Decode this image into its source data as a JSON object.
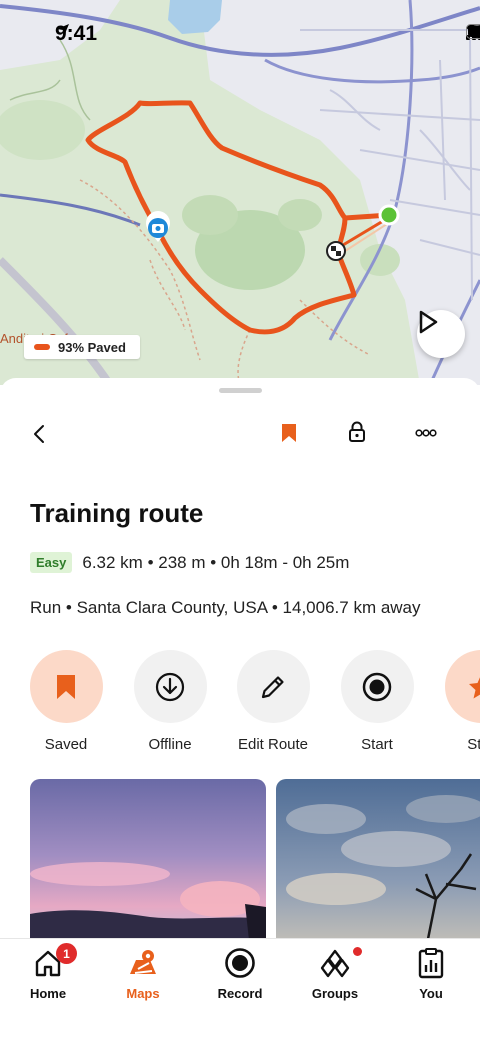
{
  "status_bar": {
    "time": "9:41"
  },
  "map": {
    "surface_label": "93% Paved",
    "place_label": "Anditeri Cafe",
    "route_color": "#e8541c",
    "start_color": "#5bc236"
  },
  "toolbar": {
    "back_icon": "chevron-left-icon",
    "save_icon": "bookmark-icon",
    "privacy_icon": "lock-icon",
    "more_icon": "more-icon"
  },
  "route": {
    "title": "Training route",
    "difficulty": "Easy",
    "stats": "6.32 km • 238 m • 0h 18m - 0h 25m",
    "meta": "Run • Santa Clara County, USA • 14,006.7 km away"
  },
  "actions": [
    {
      "label": "Saved",
      "icon": "bookmark-icon"
    },
    {
      "label": "Offline",
      "icon": "download-icon"
    },
    {
      "label": "Edit Route",
      "icon": "pencil-icon"
    },
    {
      "label": "Start",
      "icon": "record-icon"
    },
    {
      "label": "Star",
      "icon": "star-icon"
    }
  ],
  "nav": {
    "items": [
      {
        "label": "Home",
        "icon": "home-icon",
        "badge": "1"
      },
      {
        "label": "Maps",
        "icon": "maps-icon"
      },
      {
        "label": "Record",
        "icon": "record-icon"
      },
      {
        "label": "Groups",
        "icon": "groups-icon"
      },
      {
        "label": "You",
        "icon": "you-icon"
      }
    ]
  },
  "colors": {
    "accent": "#e8601c",
    "accent_soft": "#fcd9c8",
    "easy_bg": "#dff3d6",
    "easy_text": "#2f7d2a"
  }
}
